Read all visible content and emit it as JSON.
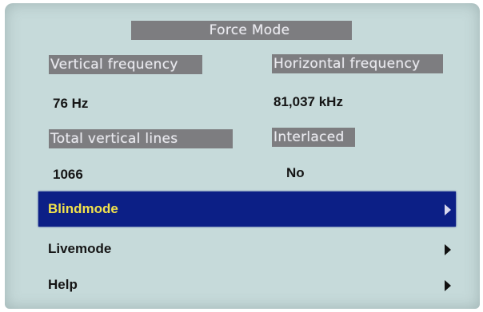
{
  "title": "Force Mode",
  "info": {
    "vertical_frequency": {
      "label": "Vertical frequency",
      "value": "76 Hz"
    },
    "horizontal_frequency": {
      "label": "Horizontal frequency",
      "value": "81,037 kHz"
    },
    "total_vertical_lines": {
      "label": "Total vertical lines",
      "value": "1066"
    },
    "interlaced": {
      "label": "Interlaced",
      "value": "No"
    }
  },
  "menu": {
    "items": [
      {
        "label": "Blindmode",
        "selected": true,
        "icon": "chevron-right-icon"
      },
      {
        "label": "Livemode",
        "selected": false,
        "icon": "chevron-right-icon"
      },
      {
        "label": "Help",
        "selected": false,
        "icon": "chevron-right-icon"
      }
    ]
  },
  "colors": {
    "screen_background": "#c6dada",
    "label_panel": "#7d7d80",
    "selection_background": "#0c1f86",
    "selected_text": "#f2e24c"
  }
}
